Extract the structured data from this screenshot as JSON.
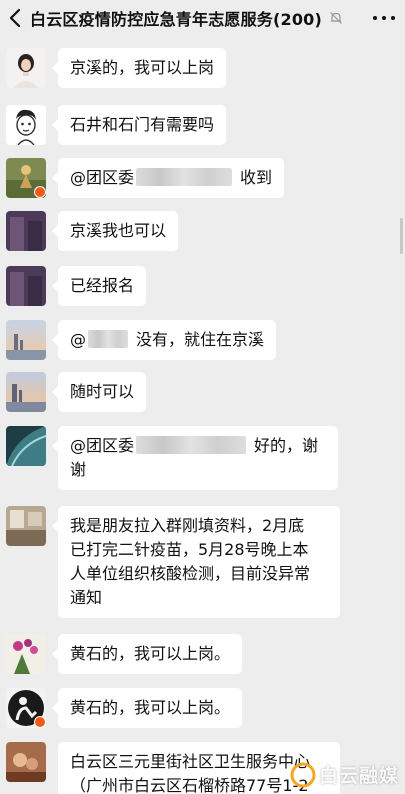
{
  "header": {
    "back_label": "<",
    "title": "白云区疫情防控应急青年志愿服务(200)"
  },
  "messages": [
    {
      "text": "京溪的，我可以上岗"
    },
    {
      "text": "石井和石门有需要吗"
    },
    {
      "prefix": "@团区委",
      "suffix": "收到"
    },
    {
      "text": "京溪我也可以"
    },
    {
      "text": "已经报名"
    },
    {
      "prefix": "@",
      "suffix": "没有，就住在京溪"
    },
    {
      "text": "随时可以"
    },
    {
      "prefix": "@团区委",
      "suffix": "好的，谢",
      "line2": "谢"
    },
    {
      "lines": [
        "我是朋友拉入群刚填资料，2月底",
        "已打完二针疫苗，5月28号晚上本",
        "人单位组织核酸检测，目前没异常",
        "通知"
      ]
    },
    {
      "text": "黄石的，我可以上岗。"
    },
    {
      "text": "黄石的，我可以上岗。"
    },
    {
      "lines": [
        "白云区三元里街社区卫生服务中心",
        "（广州市白云区石榴桥路77号1-2"
      ]
    }
  ],
  "watermark": {
    "text": "白云融媒"
  }
}
